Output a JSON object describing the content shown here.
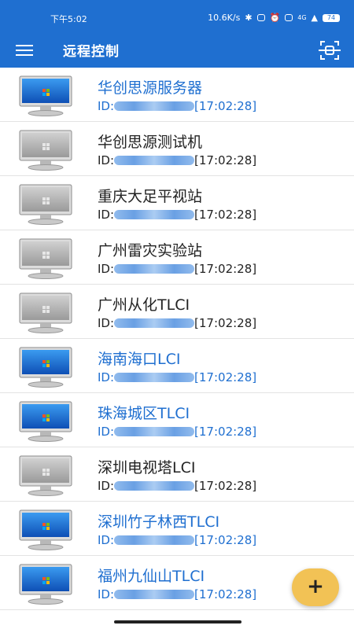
{
  "status_bar": {
    "time": "下午5:02",
    "net_speed": "10.6K/s",
    "signal": "4G",
    "battery": "74"
  },
  "app_bar": {
    "title": "远程控制",
    "menu_icon": "hamburger-menu-icon",
    "scan_icon": "scan-frame-icon"
  },
  "devices": [
    {
      "name": "华创思源服务器",
      "id_prefix": "ID:",
      "time": "[17:02:28]",
      "online": true
    },
    {
      "name": "华创思源测试机",
      "id_prefix": "ID:",
      "time": "[17:02:28]",
      "online": false
    },
    {
      "name": "重庆大足平视站",
      "id_prefix": "ID:",
      "time": "[17:02:28]",
      "online": false
    },
    {
      "name": "广州雷灾实验站",
      "id_prefix": "ID:",
      "time": "[17:02:28]",
      "online": false
    },
    {
      "name": "广州从化TLCI",
      "id_prefix": "ID:",
      "time": "[17:02:28]",
      "online": false
    },
    {
      "name": "海南海口LCI",
      "id_prefix": "ID:",
      "time": "[17:02:28]",
      "online": true
    },
    {
      "name": "珠海城区TLCI",
      "id_prefix": "ID:",
      "time": "[17:02:28]",
      "online": true
    },
    {
      "name": "深圳电视塔LCI",
      "id_prefix": "ID:",
      "time": "[17:02:28]",
      "online": false
    },
    {
      "name": "深圳竹子林西TLCI",
      "id_prefix": "ID:",
      "time": "[17:02:28]",
      "online": true
    },
    {
      "name": "福州九仙山TLCI",
      "id_prefix": "ID:",
      "time": "[17:02:28]",
      "online": true
    }
  ],
  "fab": {
    "label": "+"
  },
  "colors": {
    "primary": "#1f6fd0",
    "online_text": "#1f6fd0",
    "offline_text": "#222222",
    "fab": "#f2c255"
  }
}
